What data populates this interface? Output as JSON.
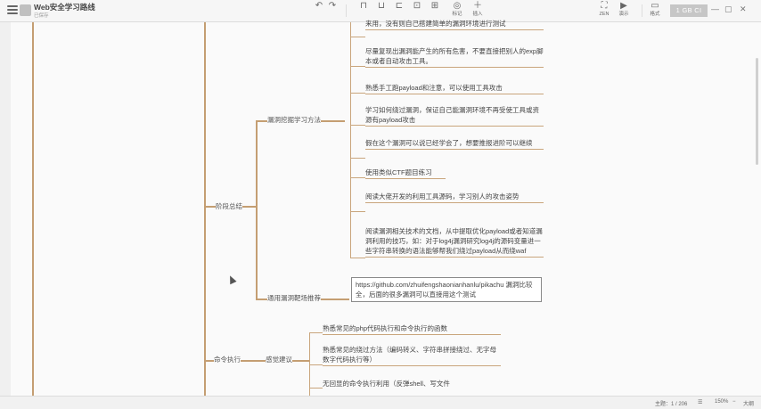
{
  "window": {
    "title": "Web安全学习路线",
    "subtitle": "已保存"
  },
  "toolbar": {
    "buttons": [
      {
        "label": "",
        "icon": "undo-icon"
      },
      {
        "label": "",
        "icon": "redo-icon"
      },
      {
        "label": "",
        "icon": "format-icon"
      },
      {
        "label": "",
        "icon": "style-icon"
      },
      {
        "label": "",
        "icon": "text-icon"
      },
      {
        "label": "",
        "icon": "node-icon"
      },
      {
        "label": "",
        "icon": "subnode-icon"
      },
      {
        "label": "标记",
        "icon": "tag-icon"
      },
      {
        "label": "插入",
        "icon": "insert-icon"
      }
    ],
    "right_items": [
      {
        "label": "ZEN",
        "icon": "zen-icon"
      },
      {
        "label": "演示",
        "icon": "present-icon"
      },
      {
        "label": "格式",
        "icon": "format-panel-icon"
      }
    ],
    "account_box": "1 GB CI",
    "accent": "#c49e72"
  },
  "mindmap": {
    "branch_main_1": "阶段总结",
    "branch_main_2": "命令执行",
    "sub_branch_1": "漏洞挖掘学习方法",
    "sub_branch_2": "通用漏洞靶场推荐",
    "sub_branch_3": "感觉建议",
    "leaves": [
      "来用，没有则自己搭建简单的漏洞环境进行测试",
      "尽量复现出漏洞能产生的所有危害，不要直接把别人的exp脚本或者自动攻击工具。",
      "熟悉手工跑payload和注意，可以使用工具攻击",
      "学习如何绕过漏洞，保证自己能漏洞环境不再受使工具或资源有payload攻击",
      "假在这个漏洞可以说已经学会了，想要推报进阶可以继续",
      "使用类似CTF题目练习",
      "阅读大佬开发的利用工具源码，学习别人的攻击姿势",
      "阅读漏洞相关技术的文档，从中提取优化payload或者知道漏洞利用的技巧，如：对于log4j漏洞研究log4j的源码变量进一些字符串转换的语法能够帮我们绕过payload从而绕waf"
    ],
    "card_text": "https://github.com/zhuifengshaonianhanlu/pikachu 漏洞比较全，后面的很多漏洞可以直接用这个测试",
    "cmd_leaves": [
      "熟悉常见的php代码执行和命令执行的函数",
      "熟悉常见的绕过方法（编码转义、字符串拼接绕过、无字母数字代码执行等）",
      "无回显的命令执行利用（反弹shell、写文件"
    ]
  },
  "statusbar": {
    "item1": "主题：1 / 206",
    "item2": "☰",
    "zoom": "150%",
    "item4": "大纲"
  }
}
